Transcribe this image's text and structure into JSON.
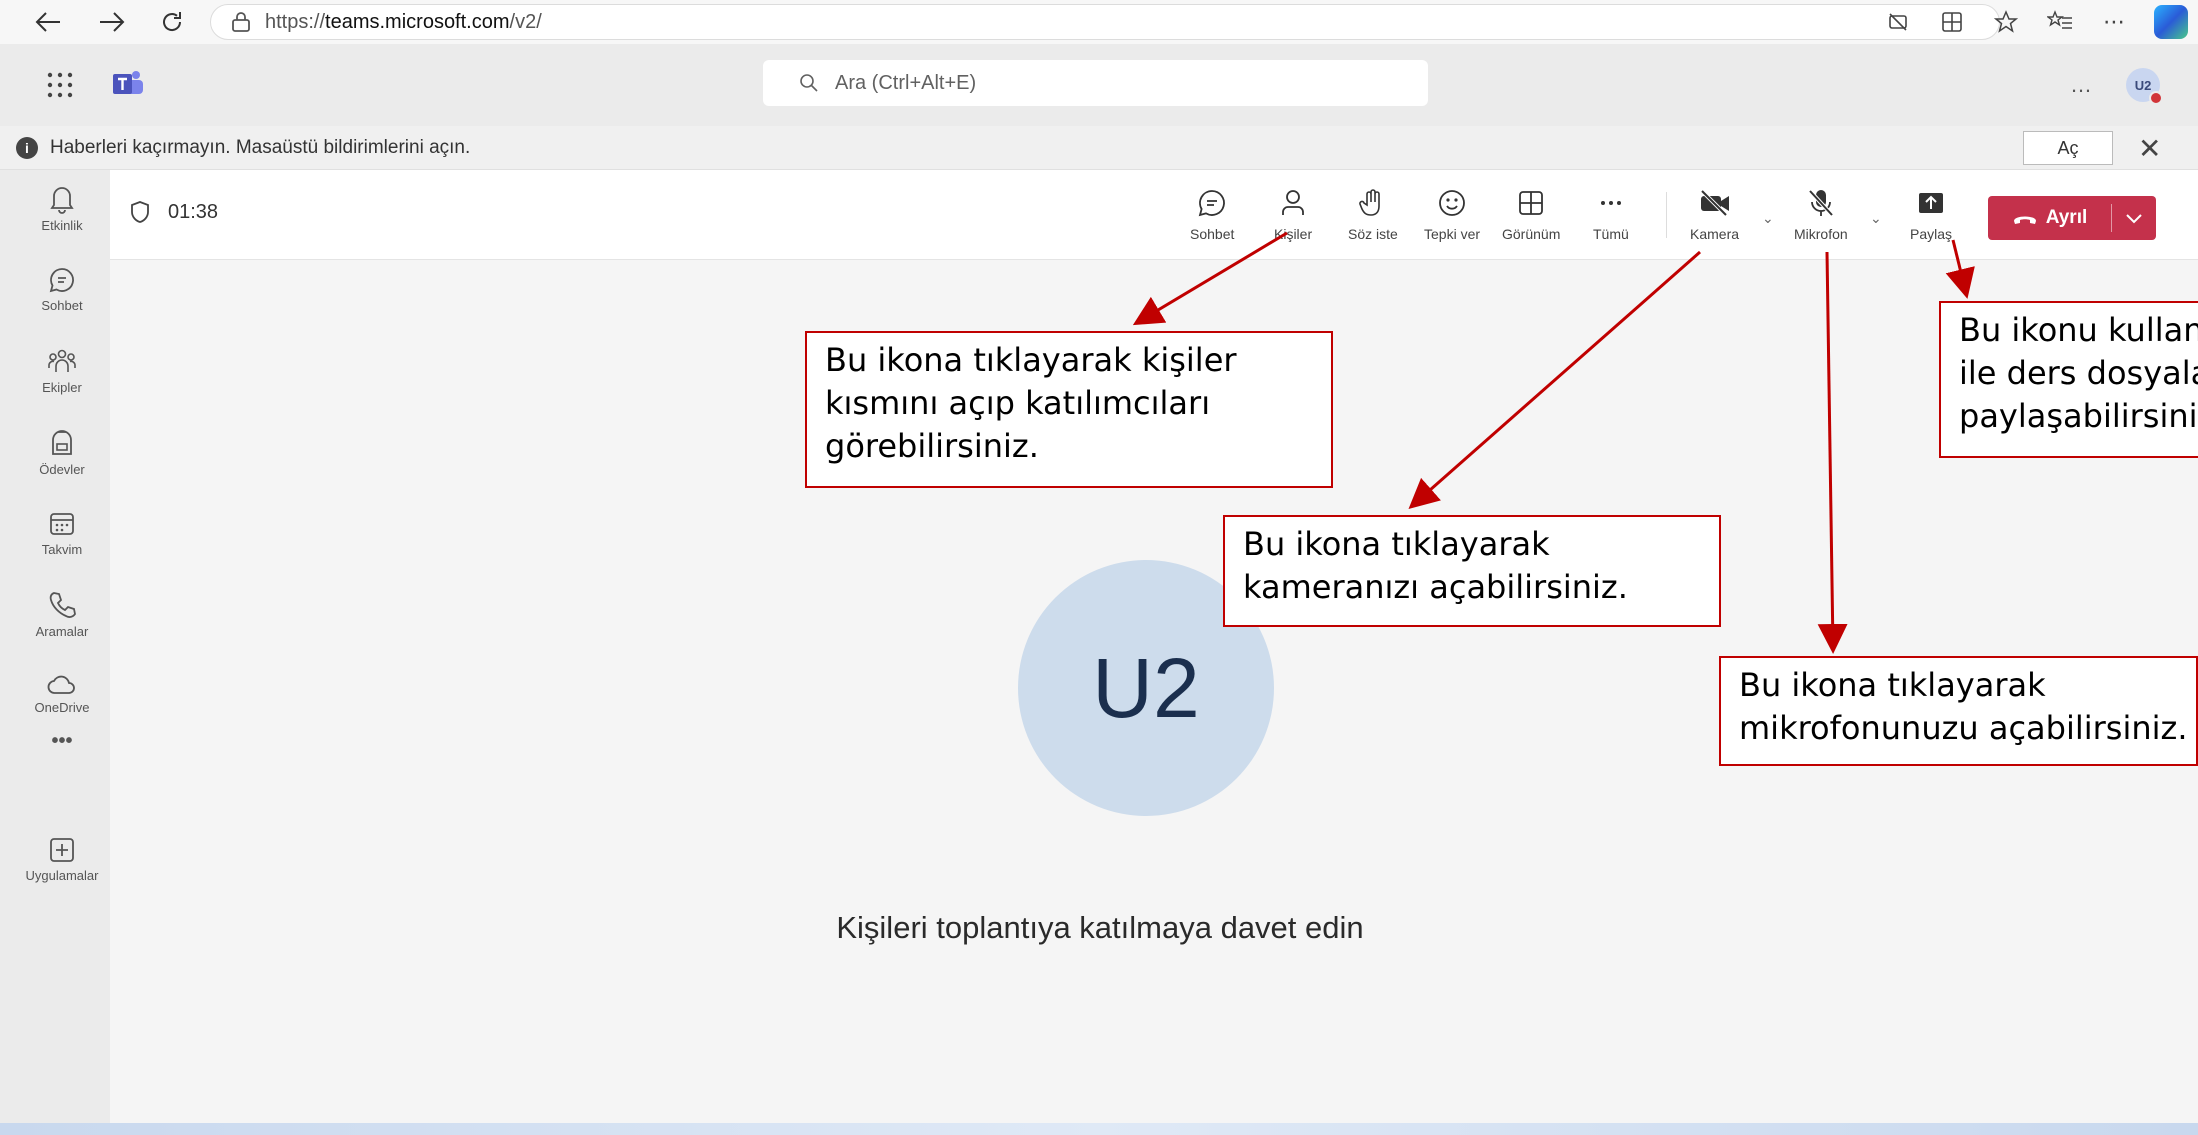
{
  "browser": {
    "url_prefix": "https://",
    "url_host": "teams.microsoft.com",
    "url_path": "/v2/"
  },
  "header": {
    "search_placeholder": "Ara (Ctrl+Alt+E)",
    "more": "…",
    "avatar": "U2"
  },
  "banner": {
    "message": "Haberleri kaçırmayın. Masaüstü bildirimlerini açın.",
    "open_label": "Aç"
  },
  "rail": {
    "items": [
      {
        "label": "Etkinlik",
        "icon": "bell-icon"
      },
      {
        "label": "Sohbet",
        "icon": "chat-icon"
      },
      {
        "label": "Ekipler",
        "icon": "teams-icon"
      },
      {
        "label": "Ödevler",
        "icon": "assignments-icon"
      },
      {
        "label": "Takvim",
        "icon": "calendar-icon"
      },
      {
        "label": "Aramalar",
        "icon": "phone-icon"
      },
      {
        "label": "OneDrive",
        "icon": "cloud-icon"
      },
      {
        "label": "Uygulamalar",
        "icon": "add-app-icon"
      }
    ],
    "more": "•••"
  },
  "meeting": {
    "timer": "01:38",
    "toolbar": {
      "chat": "Sohbet",
      "people": "Kişiler",
      "raise": "Söz iste",
      "react": "Tepki ver",
      "view": "Görünüm",
      "more": "Tümü",
      "camera": "Kamera",
      "mic": "Mikrofon",
      "share": "Paylaş",
      "leave": "Ayrıl"
    },
    "avatar_initials": "U2",
    "invite_text": "Kişileri toplantıya katılmaya davet edin"
  },
  "notes": {
    "people": [
      "Bu ikona tıklayarak kişiler",
      "kısmını açıp katılımcıları",
      "görebilirsiniz."
    ],
    "camera": [
      "Bu ikona tıklayarak",
      "kameranızı açabilirsiniz."
    ],
    "mic": [
      "Bu ikona tıklayarak",
      "mikrofonunuzu açabilirsiniz."
    ],
    "share": [
      "Bu ikonu kullan",
      "ile ders dosyala",
      "paylaşabilirsini"
    ]
  },
  "colors": {
    "annotation": "#c00000",
    "leave_button": "#c4314b",
    "avatar_bg": "#cddcec"
  }
}
